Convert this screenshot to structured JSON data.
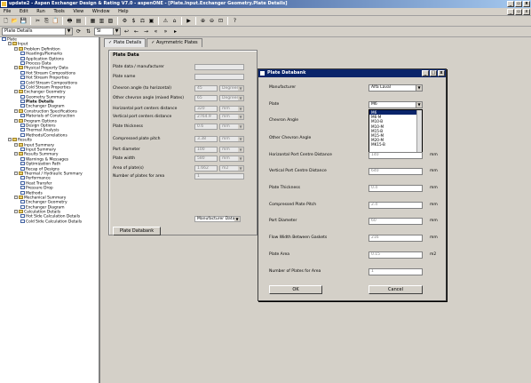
{
  "app": {
    "title": "update2 - Aspen Exchanger Design & Rating V7.0 - aspenONE - [Plate.Input.Exchanger Geometry.Plate Details]"
  },
  "menu": [
    "File",
    "Edit",
    "Run",
    "Tools",
    "View",
    "Window",
    "Help"
  ],
  "toolbar2": {
    "nav_value": "Plate Details",
    "units_value": "SI"
  },
  "tree": [
    {
      "label": "Plate",
      "level": 0,
      "type": "p"
    },
    {
      "label": "Input",
      "level": 1,
      "type": "f"
    },
    {
      "label": "Problem Definition",
      "level": 2,
      "type": "f"
    },
    {
      "label": "Headings/Remarks",
      "level": 3,
      "type": "p"
    },
    {
      "label": "Application Options",
      "level": 3,
      "type": "p"
    },
    {
      "label": "Process Data",
      "level": 3,
      "type": "p"
    },
    {
      "label": "Physical Property Data",
      "level": 2,
      "type": "f"
    },
    {
      "label": "Hot Stream Compositions",
      "level": 3,
      "type": "p"
    },
    {
      "label": "Hot Stream Properties",
      "level": 3,
      "type": "p"
    },
    {
      "label": "Cold Stream Compositions",
      "level": 3,
      "type": "p"
    },
    {
      "label": "Cold Stream Properties",
      "level": 3,
      "type": "p"
    },
    {
      "label": "Exchanger Geometry",
      "level": 2,
      "type": "f"
    },
    {
      "label": "Geometry Summary",
      "level": 3,
      "type": "p"
    },
    {
      "label": "Plate Details",
      "level": 3,
      "type": "p",
      "bold": true
    },
    {
      "label": "Exchanger Diagram",
      "level": 3,
      "type": "p"
    },
    {
      "label": "Construction Specifications",
      "level": 2,
      "type": "f"
    },
    {
      "label": "Materials of Construction",
      "level": 3,
      "type": "p"
    },
    {
      "label": "Program Options",
      "level": 2,
      "type": "f"
    },
    {
      "label": "Design Options",
      "level": 3,
      "type": "p"
    },
    {
      "label": "Thermal Analysis",
      "level": 3,
      "type": "p"
    },
    {
      "label": "Methods/Correlations",
      "level": 3,
      "type": "p"
    },
    {
      "label": "Results",
      "level": 1,
      "type": "f"
    },
    {
      "label": "Input Summary",
      "level": 2,
      "type": "f"
    },
    {
      "label": "Input Summary",
      "level": 3,
      "type": "p"
    },
    {
      "label": "Results Summary",
      "level": 2,
      "type": "f"
    },
    {
      "label": "Warnings & Messages",
      "level": 3,
      "type": "p"
    },
    {
      "label": "Optimization Path",
      "level": 3,
      "type": "p"
    },
    {
      "label": "Recap of Designs",
      "level": 3,
      "type": "p"
    },
    {
      "label": "Thermal / Hydraulic Summary",
      "level": 2,
      "type": "f"
    },
    {
      "label": "Performance",
      "level": 3,
      "type": "p"
    },
    {
      "label": "Heat Transfer",
      "level": 3,
      "type": "p"
    },
    {
      "label": "Pressure Drop",
      "level": 3,
      "type": "p"
    },
    {
      "label": "Methods",
      "level": 3,
      "type": "p"
    },
    {
      "label": "Mechanical Summary",
      "level": 2,
      "type": "f"
    },
    {
      "label": "Exchanger Geometry",
      "level": 3,
      "type": "p"
    },
    {
      "label": "Exchanger Diagram",
      "level": 3,
      "type": "p"
    },
    {
      "label": "Calculation Details",
      "level": 2,
      "type": "f"
    },
    {
      "label": "Hot Side Calculation Details",
      "level": 3,
      "type": "p"
    },
    {
      "label": "Cold Side Calculation Details",
      "level": 3,
      "type": "p"
    }
  ],
  "tabs": [
    "Plate Details",
    "Asymmetric Plates"
  ],
  "plate_data": {
    "group_title": "Plate Data",
    "fields": [
      {
        "label": "Plate data / manufacturer",
        "value": "",
        "unit": ""
      },
      {
        "label": "Plate name",
        "value": "",
        "unit": ""
      },
      {
        "label": "Chevron angle (to horizontal)",
        "value": "45",
        "unit": "Degrees"
      },
      {
        "label": "Other chevron angle (mixed Plates)",
        "value": "65",
        "unit": "Degrees"
      },
      {
        "label": "Horizontal port centers distance",
        "value": "320",
        "unit": "mm"
      },
      {
        "label": "Vertical port centers distance",
        "value": "2764.9",
        "unit": "mm"
      },
      {
        "label": "Plate thickness",
        "value": "0.6",
        "unit": "mm"
      },
      {
        "label": "Compressed plate pitch",
        "value": "3.38",
        "unit": "mm"
      },
      {
        "label": "Port diameter",
        "value": "100",
        "unit": "mm"
      },
      {
        "label": "Plate width",
        "value": "580",
        "unit": "mm"
      },
      {
        "label": "Area of plate(s)",
        "value": "1.662",
        "unit": "m2"
      },
      {
        "label": "Number of plates for area",
        "value": "1",
        "unit": ""
      }
    ],
    "source_select": "Manufacturer Data",
    "databank_button": "Plate Databank"
  },
  "dialog": {
    "title": "Plate Databank",
    "manufacturer_label": "Manufacturer",
    "manufacturer_value": "Alfa Laval",
    "plate_label": "Plate",
    "plate_value": "M6",
    "plate_options": [
      "M6",
      "M6-M",
      "M10-B",
      "M10-M",
      "M15-B",
      "M15-M",
      "M20-M",
      "MK15-B"
    ],
    "rows": [
      {
        "label": "Chevron Angle",
        "value": "",
        "unit": ""
      },
      {
        "label": "Other Chevron Angle",
        "value": "",
        "unit": ""
      },
      {
        "label": "Horizontal Port Centre Distance",
        "value": "140",
        "unit": "mm"
      },
      {
        "label": "Vertical Port Centre Distance",
        "value": "640",
        "unit": "mm"
      },
      {
        "label": "Plate Thickness",
        "value": "0.4",
        "unit": "mm"
      },
      {
        "label": "Compressed Plate Pitch",
        "value": "2.4",
        "unit": "mm"
      },
      {
        "label": "Port Diameter",
        "value": "60",
        "unit": "mm"
      },
      {
        "label": "Flow Width Between Gaskets",
        "value": "216",
        "unit": "mm"
      },
      {
        "label": "Plate Area",
        "value": "0.15",
        "unit": "m2"
      },
      {
        "label": "Number of Plates for Area",
        "value": "1",
        "unit": ""
      }
    ],
    "ok_label": "OK",
    "cancel_label": "Cancel"
  }
}
